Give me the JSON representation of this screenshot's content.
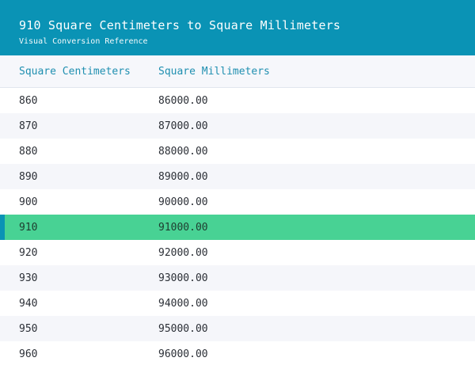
{
  "header": {
    "title": "910 Square Centimeters to Square Millimeters",
    "subtitle": "Visual Conversion Reference"
  },
  "table": {
    "columns": [
      "Square Centimeters",
      "Square Millimeters"
    ],
    "rows": [
      {
        "cm2": "860",
        "mm2": "86000.00"
      },
      {
        "cm2": "870",
        "mm2": "87000.00"
      },
      {
        "cm2": "880",
        "mm2": "88000.00"
      },
      {
        "cm2": "890",
        "mm2": "89000.00"
      },
      {
        "cm2": "900",
        "mm2": "90000.00"
      },
      {
        "cm2": "910",
        "mm2": "91000.00"
      },
      {
        "cm2": "920",
        "mm2": "92000.00"
      },
      {
        "cm2": "930",
        "mm2": "93000.00"
      },
      {
        "cm2": "940",
        "mm2": "94000.00"
      },
      {
        "cm2": "950",
        "mm2": "95000.00"
      },
      {
        "cm2": "960",
        "mm2": "96000.00"
      }
    ],
    "highlight_index": 5
  },
  "colors": {
    "header_bg": "#0a93b5",
    "highlight_row": "#48d294",
    "header_text": "#1f8fb0"
  }
}
